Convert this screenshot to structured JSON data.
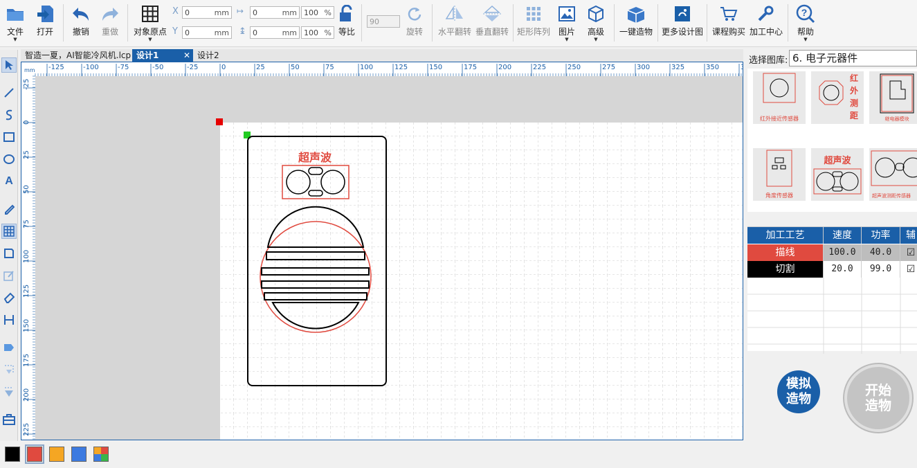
{
  "toolbar": {
    "file": "文件",
    "open": "打开",
    "undo": "撤销",
    "redo": "重做",
    "origin": "对象原点",
    "x_label": "X",
    "y_label": "Y",
    "x_value": "0",
    "y_value": "0",
    "w_value": "0",
    "h_value": "0",
    "unit": "mm",
    "w_pct": "100",
    "h_pct": "100",
    "pct_unit": "%",
    "ratio": "等比",
    "rotate_value": "90",
    "rotate": "旋转",
    "hflip": "水平翻转",
    "vflip": "垂直翻转",
    "array": "矩形阵列",
    "image": "图片",
    "advanced": "高级",
    "oneclick": "一键造物",
    "more_designs": "更多设计图",
    "buy": "课程购买",
    "process_center": "加工中心",
    "help": "帮助"
  },
  "tabs": [
    {
      "label": "智造一夏，AI智能冷风机.lcp"
    },
    {
      "label": "设计1",
      "close": "✕"
    },
    {
      "label": "设计2"
    }
  ],
  "ruler": {
    "unit": "mm",
    "h_ticks": [
      "-125",
      "-100",
      "-75",
      "-50",
      "-25",
      "0",
      "25",
      "50",
      "75",
      "100",
      "125",
      "150",
      "175",
      "200",
      "225",
      "250",
      "275",
      "300",
      "325",
      "350",
      "37"
    ],
    "v_ticks": [
      "-25",
      "0",
      "25",
      "50",
      "75",
      "100",
      "125",
      "150",
      "175",
      "200",
      "225"
    ]
  },
  "design": {
    "title_text": "超声波"
  },
  "library": {
    "label": "选择图库:",
    "selected": "6. 电子元器件",
    "items": [
      {
        "name": "红外接近传感器"
      },
      {
        "name": "红外测距",
        "chars": [
          "红",
          "外",
          "测",
          "距"
        ]
      },
      {
        "name": "继电器模块"
      },
      {
        "name": "角度传感器"
      },
      {
        "name": "超声波",
        "top": "超声波"
      },
      {
        "name": "超声波测距传感器"
      }
    ]
  },
  "process": {
    "headers": [
      "加工工艺",
      "速度",
      "功率",
      "辅"
    ],
    "rows": [
      {
        "name": "描线",
        "speed": "100.0",
        "power": "40.0",
        "color": "#e04a3f"
      },
      {
        "name": "切割",
        "speed": "20.0",
        "power": "99.0",
        "color": "#000000"
      }
    ]
  },
  "buttons": {
    "simulate": "模拟\n造物",
    "start": "开始\n造物"
  },
  "palette": {
    "colors": [
      "#000000",
      "#e04a3f",
      "#f5a623",
      "#3c7ae0",
      "multi"
    ]
  },
  "colors": {
    "accent": "#1a5fa8",
    "red": "#e04a3f"
  }
}
